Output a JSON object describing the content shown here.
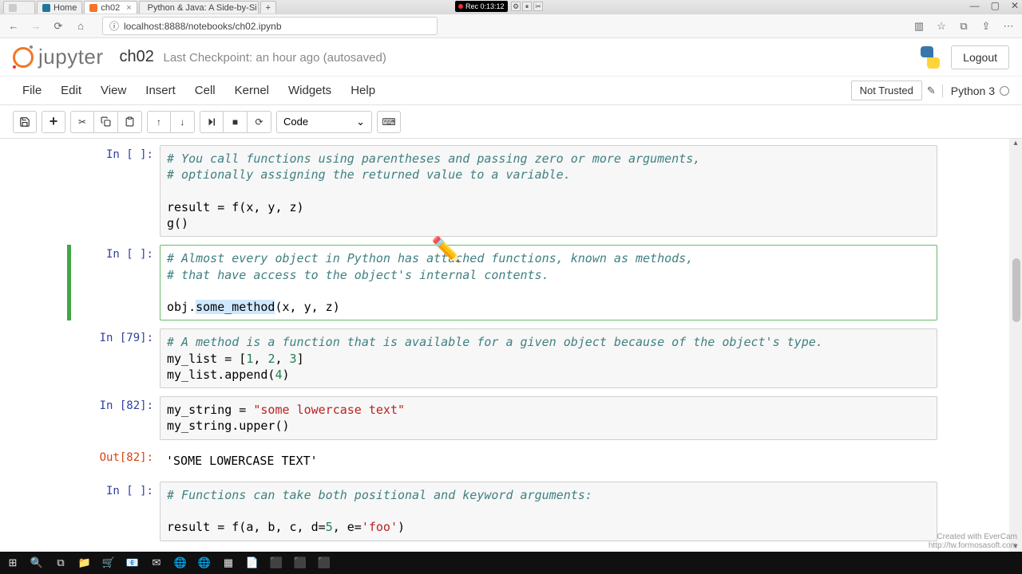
{
  "browser": {
    "tabs": [
      {
        "label": "",
        "favicon": "generic"
      },
      {
        "label": "Home",
        "favicon": "wp"
      },
      {
        "label": "ch02",
        "favicon": "jupyter",
        "active": true
      },
      {
        "label": "Python & Java: A Side-by-Si",
        "favicon": "wp"
      }
    ],
    "url": "localhost:8888/notebooks/ch02.ipynb",
    "url_prefix_icon": "ⓘ",
    "window_controls": [
      "—",
      "▢",
      "✕"
    ],
    "recorder": {
      "label": "Rec 0:13:12"
    }
  },
  "jupyter": {
    "logo_text": "jupyter",
    "title": "ch02",
    "checkpoint": "Last Checkpoint: an hour ago (autosaved)",
    "logout": "Logout",
    "menus": [
      "File",
      "Edit",
      "View",
      "Insert",
      "Cell",
      "Kernel",
      "Widgets",
      "Help"
    ],
    "not_trusted": "Not Trusted",
    "kernel": "Python 3",
    "toolbar": {
      "save": "💾",
      "add": "+",
      "cut": "✂",
      "copy": "⧉",
      "paste": "📋",
      "up": "↑",
      "down": "↓",
      "run": "▶|",
      "stop": "■",
      "restart": "⟳",
      "celltype": "Code",
      "kbd": "⌨"
    }
  },
  "cells": [
    {
      "prompt": "In [ ]:",
      "lines": [
        {
          "t": "comment",
          "v": "# You call functions using parentheses and passing zero or more arguments,"
        },
        {
          "t": "comment",
          "v": "# optionally assigning the returned value to a variable."
        },
        {
          "t": "blank",
          "v": ""
        },
        {
          "t": "code",
          "v": "result = f(x, y, z)"
        },
        {
          "t": "code",
          "v": "g()"
        }
      ]
    },
    {
      "prompt": "In [ ]:",
      "selected": true,
      "lines": [
        {
          "t": "comment",
          "v": "# Almost every object in Python has attached functions, known as methods,"
        },
        {
          "t": "comment",
          "v": "# that have access to the object's internal contents."
        },
        {
          "t": "blank",
          "v": ""
        },
        {
          "t": "code_hl",
          "pre": "obj.",
          "hl": "some_method",
          "post": "(x, y, z)"
        }
      ]
    },
    {
      "prompt": "In [79]:",
      "lines": [
        {
          "t": "comment",
          "v": "# A method is a function that is available for a given object because of the object's type."
        },
        {
          "t": "code",
          "v": "my_list = [1, 2, 3]"
        },
        {
          "t": "code",
          "v": "my_list.append(4)"
        }
      ]
    },
    {
      "prompt": "In [82]:",
      "lines": [
        {
          "t": "code",
          "v": "my_string = \"some lowercase text\""
        },
        {
          "t": "code",
          "v": "my_string.upper()"
        }
      ]
    },
    {
      "prompt": "Out[82]:",
      "output": true,
      "lines": [
        {
          "t": "out",
          "v": "'SOME LOWERCASE TEXT'"
        }
      ]
    },
    {
      "prompt": "In [ ]:",
      "lines": [
        {
          "t": "comment",
          "v": "# Functions can take both positional and keyword arguments:"
        },
        {
          "t": "blank",
          "v": ""
        },
        {
          "t": "code",
          "v": "result = f(a, b, c, d=5, e='foo')"
        }
      ]
    }
  ],
  "watermark": {
    "l1": "Created with EverCam",
    "l2": "http://tw.formosasoft.com"
  },
  "taskbar_icons": [
    "⊞",
    "🔍",
    "⧉",
    "📁",
    "🛒",
    "📧",
    "✉",
    "🌐",
    "🌐",
    "▦",
    "📄",
    "⬛",
    "⬛",
    "⬛"
  ]
}
